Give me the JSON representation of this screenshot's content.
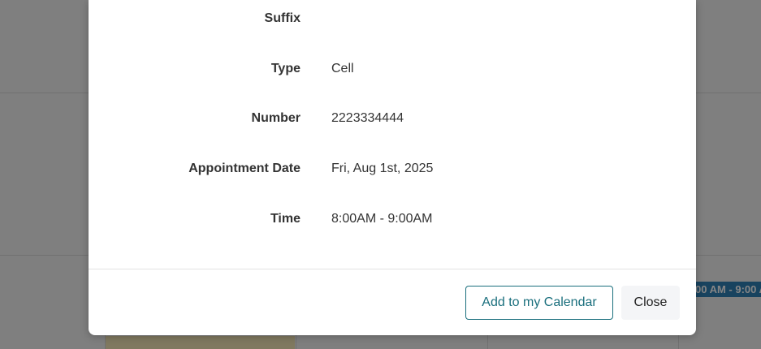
{
  "background": {
    "event_chip_text": "00 AM - 9:00 AM"
  },
  "appointment_details": {
    "rows": [
      {
        "label": "Suffix",
        "value": ""
      },
      {
        "label": "Type",
        "value": "Cell"
      },
      {
        "label": "Number",
        "value": "2223334444"
      },
      {
        "label": "Appointment Date",
        "value": "Fri, Aug 1st, 2025"
      },
      {
        "label": "Time",
        "value": "8:00AM - 9:00AM"
      }
    ]
  },
  "footer": {
    "add_to_calendar_label": "Add to my Calendar",
    "close_label": "Close"
  },
  "colors": {
    "accent": "#1a6f7d",
    "overlay": "#000000",
    "event_chip": "#2f80b7"
  }
}
